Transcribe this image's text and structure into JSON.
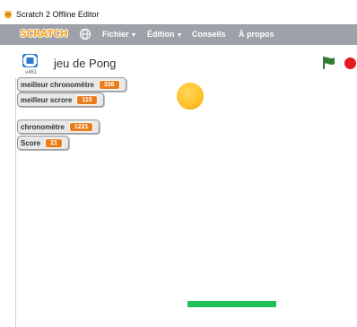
{
  "window": {
    "title": "Scratch 2 Offline Editor"
  },
  "menubar": {
    "logo": "SCRATCH",
    "items": [
      {
        "label": "Fichier",
        "has_caret": true
      },
      {
        "label": "Édition",
        "has_caret": true
      },
      {
        "label": "Conseils",
        "has_caret": false
      },
      {
        "label": "À propos",
        "has_caret": false
      }
    ]
  },
  "stage_header": {
    "project_title": "jeu de Pong",
    "version": "v461"
  },
  "monitors": [
    {
      "label": "meilleur chronomètre",
      "value": "336"
    },
    {
      "label": "meilleur scrore",
      "value": "115"
    },
    {
      "label": "chronomètre",
      "value": "1221"
    },
    {
      "label": "Score",
      "value": "21"
    }
  ],
  "colors": {
    "menubar": "#9ea2a8",
    "monitor_value": "#ec7c1a",
    "paddle": "#1fc05a",
    "ball": "#ffc22a",
    "stop": "#e31b1b",
    "flag": "#2e7d32"
  },
  "icons": {
    "app": "scratch-cat-icon",
    "language": "globe-icon",
    "presentation": "fullscreen-icon",
    "run": "green-flag-icon",
    "stop": "stop-icon"
  }
}
